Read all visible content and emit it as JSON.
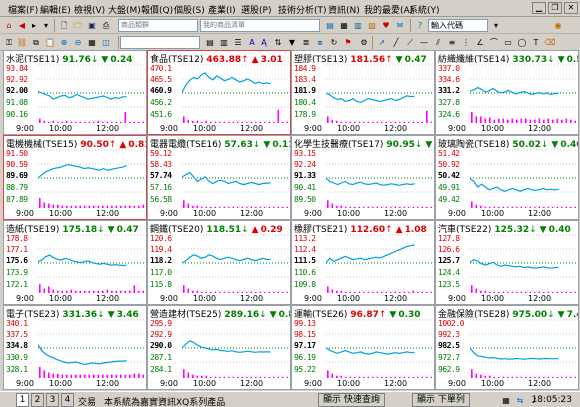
{
  "menu": [
    {
      "label": "檔案",
      "key": "(F)"
    },
    {
      "label": "編輯",
      "key": "(E)"
    },
    {
      "label": "檢視",
      "key": "(V)"
    },
    {
      "label": "大盤",
      "key": "(M)"
    },
    {
      "label": "報價",
      "key": "(Q)"
    },
    {
      "label": "個股",
      "key": "(S)"
    },
    {
      "label": "產業",
      "key": "(I)"
    },
    {
      "label": "選股",
      "key": "(P)"
    },
    {
      "label": "技術分析",
      "key": "(T)"
    },
    {
      "label": "資訊",
      "key": "(N)"
    },
    {
      "label": "我的最愛",
      "key": "(A)"
    },
    {
      "label": "系統",
      "key": "(Y)"
    }
  ],
  "toolbar": {
    "combo1": "商品類群",
    "combo2": "我的商品清單",
    "code_input_label": "輸入代碼"
  },
  "colors": {
    "up": "#e00000",
    "down": "#008000",
    "line": "#00a0e0",
    "volume": "#ff00ff",
    "ref": "#008000"
  },
  "panels": [
    {
      "name": "水泥(TSE11)",
      "price": "91.76",
      "dir": "down",
      "arrow": "↓",
      "chg_sign": "▼",
      "change": "0.24",
      "ticks": [
        "93.84",
        "92.92",
        "92.00",
        "91.08",
        "90.16"
      ],
      "ref_tick": 2,
      "times": [
        "9:00",
        "10:00",
        "12:00"
      ],
      "series": [
        92.1,
        92.0,
        91.9,
        91.8,
        91.6,
        91.7,
        91.8,
        91.85,
        91.7,
        91.75,
        91.9,
        91.8,
        91.7,
        91.6,
        91.65,
        91.7,
        91.75,
        91.8,
        91.7,
        91.6,
        91.7,
        91.65,
        91.75,
        91.76
      ],
      "min": 90.16,
      "max": 93.84,
      "vol": [
        0.2,
        0.1,
        0.05,
        0.1,
        0.05,
        0.05,
        0.1,
        0.05,
        0.05,
        0.05,
        0.05,
        0.05,
        0.05,
        0.1,
        0.05,
        0.05,
        0.05,
        0.05,
        0.05,
        0.5,
        0.05,
        0.05,
        0.05,
        0.05
      ]
    },
    {
      "name": "食品(TSE12)",
      "price": "463.88",
      "dir": "up",
      "arrow": "↑",
      "chg_sign": "▲",
      "change": "3.01",
      "ticks": [
        "470.1",
        "465.5",
        "460.9",
        "456.2",
        "451.6"
      ],
      "ref_tick": 2,
      "times": [
        "9:00",
        "10:00",
        "12:00"
      ],
      "series": [
        461.0,
        463.5,
        465.0,
        466.0,
        465.5,
        466.8,
        467.5,
        466.0,
        465.2,
        466.5,
        465.8,
        464.9,
        465.3,
        466.0,
        465.2,
        464.5,
        464.9,
        465.5,
        464.8,
        464.0,
        464.5,
        463.9,
        464.2,
        463.88
      ],
      "min": 451.6,
      "max": 470.1,
      "vol": [
        0.3,
        0.15,
        0.1,
        0.1,
        0.05,
        0.1,
        0.05,
        0.05,
        0.05,
        0.05,
        0.05,
        0.05,
        0.05,
        0.05,
        0.05,
        0.05,
        0.05,
        0.05,
        0.05,
        0.05,
        0.05,
        0.6,
        0.05,
        0.05
      ]
    },
    {
      "name": "塑膠(TSE13)",
      "price": "181.56",
      "dir": "up",
      "arrow": "↑",
      "chg_sign": "▼",
      "change": "0.47",
      "ticks": [
        "184.9",
        "183.4",
        "181.9",
        "180.4",
        "178.9"
      ],
      "ref_tick": 2,
      "times": [
        "9:00",
        "10:00",
        "12:00"
      ],
      "series": [
        181.9,
        181.7,
        181.4,
        181.2,
        181.3,
        181.0,
        181.1,
        181.3,
        181.0,
        180.9,
        181.1,
        181.3,
        181.2,
        181.1,
        181.0,
        181.1,
        181.2,
        181.3,
        181.1,
        181.2,
        181.4,
        181.6,
        181.5,
        181.56
      ],
      "min": 178.9,
      "max": 184.9,
      "vol": [
        0.3,
        0.15,
        0.1,
        0.05,
        0.05,
        0.05,
        0.05,
        0.05,
        0.05,
        0.05,
        0.05,
        0.05,
        0.05,
        0.05,
        0.05,
        0.05,
        0.05,
        0.05,
        0.05,
        0.05,
        0.05,
        0.05,
        0.55,
        0.05
      ]
    },
    {
      "name": "紡織纖維(TSE14)",
      "price": "330.73",
      "dir": "down",
      "arrow": "↓",
      "chg_sign": "▼",
      "change": "0.50",
      "ticks": [
        "337.0",
        "334.6",
        "331.2",
        "327.8",
        "324.6"
      ],
      "ref_tick": 2,
      "times": [
        "9:00",
        "10:00",
        "12:00"
      ],
      "series": [
        331.2,
        331.5,
        332.0,
        331.6,
        331.0,
        331.3,
        331.8,
        331.2,
        330.8,
        331.0,
        331.4,
        330.9,
        330.6,
        330.9,
        331.1,
        330.8,
        330.5,
        330.7,
        330.9,
        330.6,
        330.8,
        330.5,
        330.7,
        330.73
      ],
      "min": 324.6,
      "max": 337.0,
      "vol": [
        0.5,
        0.3,
        0.3,
        0.2,
        0.25,
        0.15,
        0.2,
        0.2,
        0.15,
        0.2,
        0.15,
        0.2,
        0.2,
        0.15,
        0.15,
        0.2,
        0.15,
        0.2,
        0.15,
        0.2,
        0.15,
        0.2,
        0.15,
        0.1
      ]
    },
    {
      "name": "電機機械(TSE15)",
      "price": "90.50",
      "dir": "up",
      "arrow": "↑",
      "chg_sign": "▲",
      "change": "0.81",
      "ticks": [
        "91.50",
        "90.59",
        "89.69",
        "88.79",
        "87.89"
      ],
      "ref_tick": 2,
      "times": [
        "9:00",
        "10:00",
        "12:00"
      ],
      "series": [
        89.7,
        89.9,
        90.1,
        90.2,
        90.3,
        90.35,
        90.4,
        90.5,
        90.55,
        90.5,
        90.45,
        90.4,
        90.3,
        90.35,
        90.3,
        90.25,
        90.2,
        90.3,
        90.2,
        90.25,
        90.3,
        90.35,
        90.4,
        90.5
      ],
      "min": 87.89,
      "max": 91.5,
      "vol": [
        0.45,
        0.25,
        0.2,
        0.15,
        0.15,
        0.1,
        0.1,
        0.1,
        0.1,
        0.1,
        0.1,
        0.1,
        0.1,
        0.1,
        0.1,
        0.1,
        0.1,
        0.1,
        0.1,
        0.1,
        0.1,
        0.1,
        0.1,
        0.15
      ]
    },
    {
      "name": "電器電纜(TSE16)",
      "price": "57.63",
      "dir": "down",
      "arrow": "↓",
      "chg_sign": "▼",
      "change": "0.11",
      "ticks": [
        "59.12",
        "58.43",
        "57.74",
        "57.16",
        "56.58"
      ],
      "ref_tick": 2,
      "times": [
        "9:00",
        "10:00",
        "12:00"
      ],
      "series": [
        57.9,
        58.0,
        58.1,
        57.9,
        57.7,
        57.8,
        57.9,
        57.7,
        57.6,
        57.7,
        57.75,
        57.7,
        57.6,
        57.65,
        57.7,
        57.6,
        57.55,
        57.6,
        57.65,
        57.6,
        57.55,
        57.6,
        57.62,
        57.63
      ],
      "min": 56.58,
      "max": 59.12,
      "vol": [
        0.35,
        0.2,
        0.1,
        0.1,
        0.05,
        0.05,
        0.05,
        0.05,
        0.05,
        0.05,
        0.05,
        0.05,
        0.05,
        0.05,
        0.05,
        0.05,
        0.05,
        0.05,
        0.05,
        0.05,
        0.05,
        0.05,
        0.05,
        0.05
      ]
    },
    {
      "name": "化學生技醫療(TSE17)",
      "price": "90.95",
      "dir": "down",
      "arrow": "↓",
      "chg_sign": "▼",
      "change": "0.38",
      "ticks": [
        "93.15",
        "92.24",
        "91.33",
        "90.41",
        "89.50"
      ],
      "ref_tick": 2,
      "times": [
        "9:00",
        "10:00",
        "12:00"
      ],
      "series": [
        91.3,
        91.1,
        91.0,
        90.9,
        91.0,
        91.1,
        90.95,
        90.9,
        91.0,
        91.05,
        90.95,
        90.9,
        90.95,
        91.0,
        90.9,
        90.85,
        90.9,
        90.95,
        90.9,
        90.85,
        90.9,
        90.95,
        90.9,
        90.95
      ],
      "min": 89.5,
      "max": 93.15,
      "vol": [
        0.35,
        0.2,
        0.1,
        0.1,
        0.05,
        0.05,
        0.05,
        0.05,
        0.05,
        0.05,
        0.05,
        0.05,
        0.05,
        0.05,
        0.05,
        0.05,
        0.05,
        0.05,
        0.05,
        0.05,
        0.05,
        0.05,
        0.05,
        0.05
      ]
    },
    {
      "name": "玻璃陶瓷(TSE18)",
      "price": "50.02",
      "dir": "down",
      "arrow": "↓",
      "chg_sign": "▼",
      "change": "0.40",
      "ticks": [
        "51.42",
        "50.92",
        "50.42",
        "49.91",
        "49.42"
      ],
      "ref_tick": 2,
      "times": [
        "9:00",
        "10:00",
        "12:00"
      ],
      "series": [
        50.4,
        50.3,
        50.1,
        50.2,
        50.1,
        50.0,
        50.05,
        50.1,
        50.0,
        49.95,
        50.0,
        50.05,
        50.0,
        49.95,
        50.0,
        50.05,
        50.0,
        49.98,
        50.0,
        50.05,
        50.0,
        50.02,
        50.0,
        50.02
      ],
      "min": 49.42,
      "max": 51.42,
      "vol": [
        0.3,
        0.15,
        0.1,
        0.05,
        0.05,
        0.05,
        0.05,
        0.05,
        0.05,
        0.05,
        0.05,
        0.05,
        0.05,
        0.05,
        0.05,
        0.05,
        0.05,
        0.05,
        0.05,
        0.05,
        0.05,
        0.05,
        0.05,
        0.05
      ]
    },
    {
      "name": "造紙(TSE19)",
      "price": "175.18",
      "dir": "down",
      "arrow": "↓",
      "chg_sign": "▼",
      "change": "0.47",
      "ticks": [
        "178.8",
        "177.1",
        "175.6",
        "173.9",
        "172.1"
      ],
      "ref_tick": 2,
      "times": [
        "9:00",
        "10:00",
        "12:00"
      ],
      "series": [
        175.6,
        175.8,
        176.2,
        176.4,
        176.1,
        175.9,
        175.8,
        176.0,
        175.9,
        175.7,
        175.6,
        175.5,
        175.6,
        175.7,
        175.5,
        175.4,
        175.3,
        175.4,
        175.3,
        175.2,
        175.25,
        175.2,
        175.15,
        175.18
      ],
      "min": 172.1,
      "max": 178.8,
      "vol": [
        0.4,
        0.2,
        0.3,
        0.15,
        0.1,
        0.1,
        0.1,
        0.15,
        0.1,
        0.1,
        0.1,
        0.1,
        0.1,
        0.1,
        0.1,
        0.15,
        0.1,
        0.1,
        0.1,
        0.1,
        0.1,
        0.35,
        0.1,
        0.1
      ]
    },
    {
      "name": "鋼鐵(TSE20)",
      "price": "118.51",
      "dir": "down",
      "arrow": "↓",
      "chg_sign": "▲",
      "change": "0.29",
      "ticks": [
        "120.6",
        "119.4",
        "118.2",
        "117.0",
        "115.8"
      ],
      "ref_tick": 2,
      "times": [
        "9:00",
        "10:00",
        "12:00"
      ],
      "series": [
        118.2,
        118.4,
        118.7,
        118.9,
        118.8,
        118.6,
        118.7,
        118.9,
        118.8,
        118.6,
        118.5,
        118.6,
        118.7,
        118.6,
        118.5,
        118.4,
        118.5,
        118.6,
        118.5,
        118.4,
        118.5,
        118.6,
        118.5,
        118.51
      ],
      "min": 115.8,
      "max": 120.6,
      "vol": [
        0.35,
        0.2,
        0.1,
        0.1,
        0.05,
        0.05,
        0.05,
        0.05,
        0.05,
        0.05,
        0.05,
        0.05,
        0.05,
        0.05,
        0.05,
        0.05,
        0.05,
        0.05,
        0.05,
        0.05,
        0.05,
        0.05,
        0.05,
        0.05
      ]
    },
    {
      "name": "橡膠(TSE21)",
      "price": "112.60",
      "dir": "up",
      "arrow": "↑",
      "chg_sign": "▲",
      "change": "1.08",
      "ticks": [
        "113.2",
        "112.4",
        "111.5",
        "110.6",
        "109.8"
      ],
      "ref_tick": 2,
      "times": [
        "9:00",
        "10:00",
        "12:00"
      ],
      "series": [
        111.5,
        111.8,
        111.6,
        111.7,
        111.8,
        111.9,
        111.8,
        111.7,
        111.75,
        111.8,
        111.7,
        111.75,
        111.8,
        111.85,
        111.8,
        111.9,
        112.0,
        112.1,
        112.2,
        112.3,
        112.4,
        112.5,
        112.55,
        112.6
      ],
      "min": 109.8,
      "max": 113.2,
      "vol": [
        0.3,
        0.15,
        0.1,
        0.1,
        0.05,
        0.05,
        0.05,
        0.05,
        0.05,
        0.05,
        0.05,
        0.05,
        0.05,
        0.05,
        0.05,
        0.05,
        0.05,
        0.05,
        0.05,
        0.1,
        0.05,
        0.05,
        0.05,
        0.05
      ]
    },
    {
      "name": "汽車(TSE22)",
      "price": "125.32",
      "dir": "down",
      "arrow": "↓",
      "chg_sign": "▼",
      "change": "0.40",
      "ticks": [
        "127.8",
        "126.6",
        "125.7",
        "124.4",
        "123.5"
      ],
      "ref_tick": 2,
      "times": [
        "9:00",
        "10:00",
        "12:00"
      ],
      "series": [
        125.7,
        125.9,
        125.8,
        125.6,
        125.5,
        125.6,
        125.7,
        125.5,
        125.4,
        125.5,
        125.45,
        125.4,
        125.35,
        125.4,
        125.3,
        125.35,
        125.3,
        125.25,
        125.3,
        125.35,
        125.3,
        125.25,
        125.3,
        125.32
      ],
      "min": 123.5,
      "max": 127.8,
      "vol": [
        0.35,
        0.2,
        0.1,
        0.1,
        0.05,
        0.05,
        0.05,
        0.05,
        0.05,
        0.05,
        0.05,
        0.05,
        0.05,
        0.05,
        0.05,
        0.05,
        0.05,
        0.05,
        0.05,
        0.05,
        0.05,
        0.05,
        0.05,
        0.05
      ]
    },
    {
      "name": "電子(TSE23)",
      "price": "331.36",
      "dir": "down",
      "arrow": "↓",
      "chg_sign": "▼",
      "change": "3.46",
      "ticks": [
        "340.1",
        "337.5",
        "334.8",
        "330.9",
        "328.1"
      ],
      "ref_tick": 2,
      "times": [
        "9:00",
        "10:00",
        "12:00"
      ],
      "series": [
        334.8,
        333.5,
        332.8,
        332.3,
        332.0,
        331.6,
        331.3,
        331.0,
        330.9,
        331.0,
        331.1,
        330.8,
        330.6,
        330.7,
        330.9,
        330.8,
        330.7,
        330.9,
        331.0,
        331.1,
        331.2,
        331.3,
        331.3,
        331.36
      ],
      "min": 328.1,
      "max": 340.1,
      "vol": [
        0.5,
        0.35,
        0.25,
        0.2,
        0.2,
        0.15,
        0.15,
        0.15,
        0.15,
        0.15,
        0.15,
        0.15,
        0.15,
        0.15,
        0.15,
        0.15,
        0.15,
        0.15,
        0.15,
        0.15,
        0.15,
        0.2,
        0.2,
        0.15
      ]
    },
    {
      "name": "營造建材(TSE25)",
      "price": "289.16",
      "dir": "down",
      "arrow": "↓",
      "chg_sign": "▼",
      "change": "0.82",
      "ticks": [
        "295.9",
        "292.9",
        "290.0",
        "287.1",
        "284.1"
      ],
      "ref_tick": 2,
      "times": [
        "9:00",
        "10:00",
        "12:00"
      ],
      "series": [
        290.0,
        290.8,
        291.5,
        291.2,
        290.6,
        290.2,
        290.0,
        289.8,
        289.6,
        289.7,
        289.5,
        289.4,
        289.3,
        289.4,
        289.2,
        289.1,
        289.2,
        289.3,
        289.2,
        289.1,
        289.2,
        289.15,
        289.2,
        289.16
      ],
      "min": 284.1,
      "max": 295.9,
      "vol": [
        0.4,
        0.25,
        0.15,
        0.1,
        0.1,
        0.1,
        0.05,
        0.05,
        0.05,
        0.05,
        0.05,
        0.05,
        0.05,
        0.05,
        0.05,
        0.05,
        0.05,
        0.05,
        0.05,
        0.05,
        0.05,
        0.05,
        0.05,
        0.05
      ]
    },
    {
      "name": "運輸(TSE26)",
      "price": "96.87",
      "dir": "up",
      "arrow": "↑",
      "chg_sign": "▼",
      "change": "0.30",
      "ticks": [
        "99.13",
        "98.15",
        "97.17",
        "96.19",
        "95.22"
      ],
      "ref_tick": 2,
      "times": [
        "9:00",
        "10:00",
        "12:00"
      ],
      "series": [
        97.2,
        97.0,
        96.9,
        96.8,
        96.9,
        97.0,
        96.9,
        96.8,
        96.85,
        96.9,
        96.8,
        96.75,
        96.8,
        96.9,
        96.85,
        96.8,
        96.75,
        96.8,
        96.85,
        96.8,
        96.85,
        96.9,
        96.85,
        96.87
      ],
      "min": 95.22,
      "max": 99.13,
      "vol": [
        0.35,
        0.2,
        0.1,
        0.1,
        0.05,
        0.05,
        0.05,
        0.05,
        0.05,
        0.05,
        0.05,
        0.05,
        0.05,
        0.05,
        0.05,
        0.05,
        0.05,
        0.05,
        0.05,
        0.05,
        0.05,
        0.05,
        0.05,
        0.05
      ]
    },
    {
      "name": "金融保險(TSE28)",
      "price": "975.00",
      "dir": "down",
      "arrow": "↓",
      "chg_sign": "▼",
      "change": "7.46",
      "ticks": [
        "1002.0",
        "992.3",
        "982.5",
        "972.7",
        "962.9"
      ],
      "ref_tick": 2,
      "times": [
        "9:00",
        "10:00",
        "12:00"
      ],
      "series": [
        982.5,
        979.0,
        977.0,
        976.5,
        976.0,
        975.5,
        975.8,
        975.2,
        974.8,
        975.0,
        974.6,
        974.8,
        975.1,
        974.9,
        974.7,
        974.9,
        975.2,
        975.0,
        974.8,
        975.0,
        975.1,
        974.9,
        975.0,
        975.0
      ],
      "min": 962.9,
      "max": 1002.0,
      "vol": [
        0.4,
        0.2,
        0.15,
        0.1,
        0.1,
        0.05,
        0.05,
        0.05,
        0.05,
        0.05,
        0.05,
        0.05,
        0.05,
        0.05,
        0.05,
        0.05,
        0.05,
        0.05,
        0.05,
        0.05,
        0.05,
        0.05,
        0.05,
        0.05
      ]
    }
  ],
  "status": {
    "tabs": [
      "1",
      "2",
      "3",
      "4"
    ],
    "mode": "交易",
    "message": "本系統為嘉實資訊XQ系列產品",
    "btn1": "顯示 快速查詢",
    "btn2": "顯示 下單列",
    "clock": "18:05:23"
  }
}
